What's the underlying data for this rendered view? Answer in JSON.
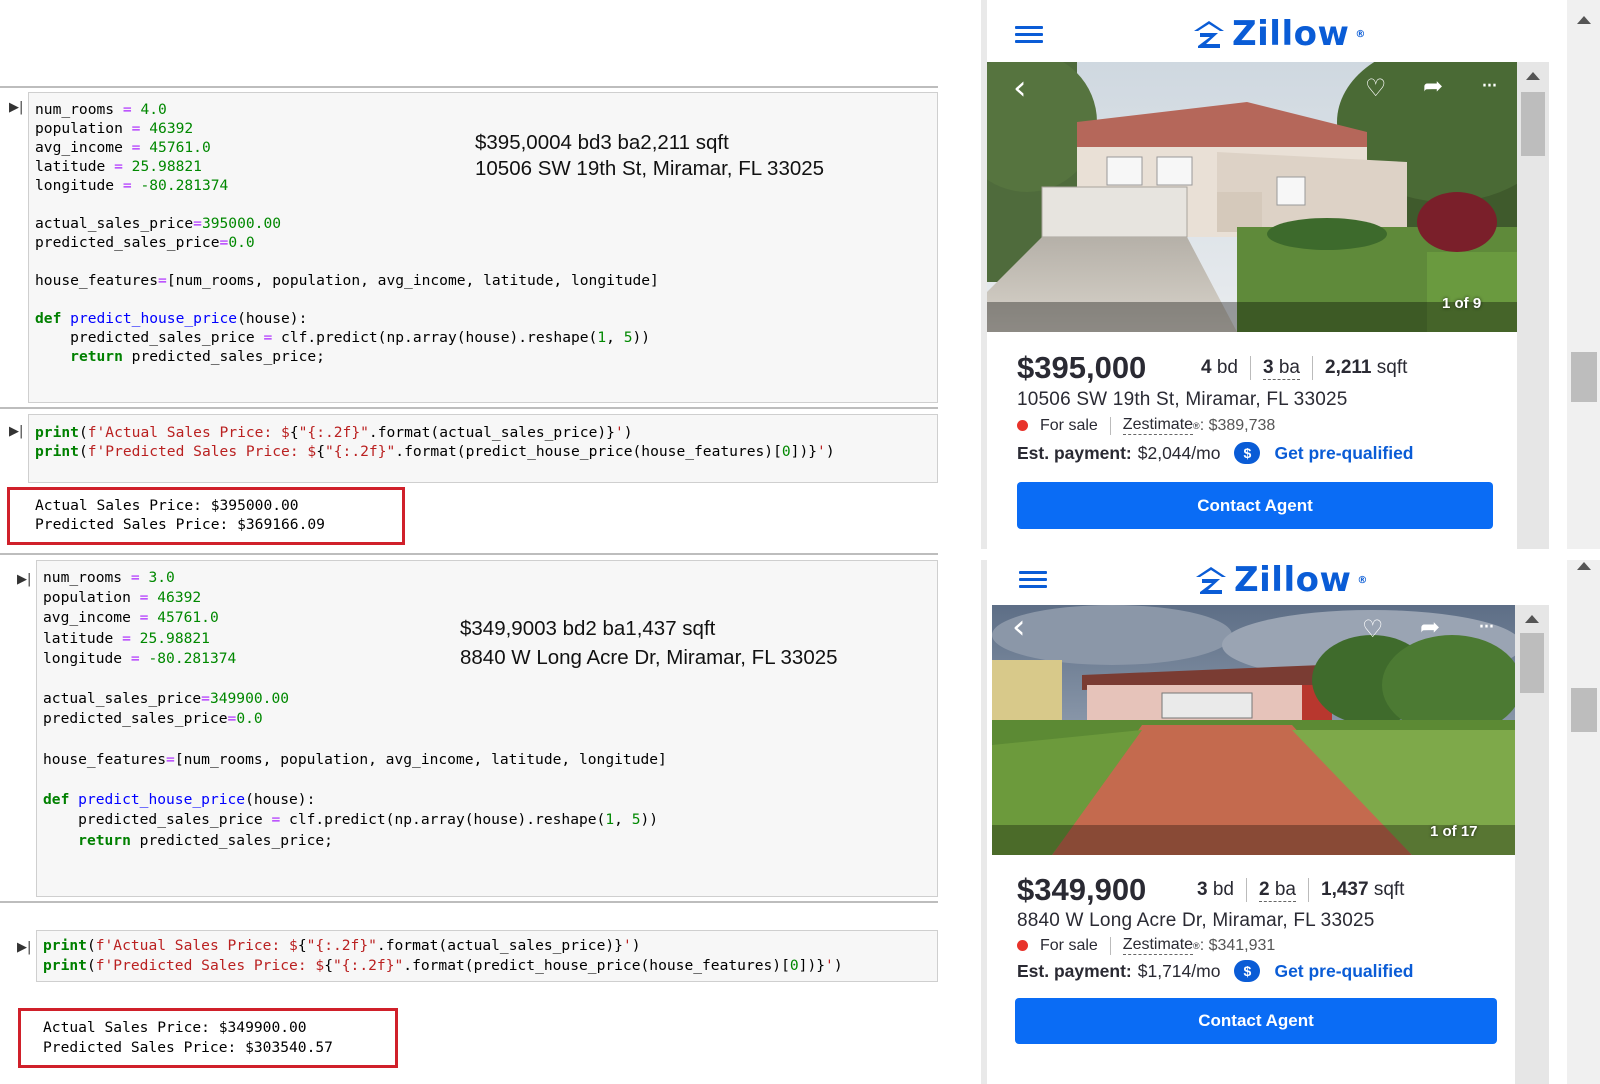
{
  "cells": [
    {
      "input_lines": [
        [
          [
            "num_rooms ",
            ""
          ],
          [
            "=",
            "op"
          ],
          [
            " ",
            ""
          ],
          [
            "4.0",
            "num"
          ]
        ],
        [
          [
            "population ",
            ""
          ],
          [
            "=",
            "op"
          ],
          [
            " ",
            ""
          ],
          [
            "46392",
            "num"
          ]
        ],
        [
          [
            "avg_income ",
            ""
          ],
          [
            "=",
            "op"
          ],
          [
            " ",
            ""
          ],
          [
            "45761.0",
            "num"
          ]
        ],
        [
          [
            "latitude ",
            ""
          ],
          [
            "=",
            "op"
          ],
          [
            " ",
            ""
          ],
          [
            "25.98821",
            "num"
          ]
        ],
        [
          [
            "longitude ",
            ""
          ],
          [
            "=",
            "op"
          ],
          [
            " ",
            ""
          ],
          [
            "-80.281374",
            "num"
          ]
        ],
        [],
        [
          [
            "actual_sales_price",
            ""
          ],
          [
            "=",
            "op"
          ],
          [
            "395000.00",
            "num"
          ]
        ],
        [
          [
            "predicted_sales_price",
            ""
          ],
          [
            "=",
            "op"
          ],
          [
            "0.0",
            "num"
          ]
        ],
        [],
        [
          [
            "house_features",
            ""
          ],
          [
            "=",
            "op"
          ],
          [
            "[num_rooms, population, avg_income, latitude, longitude]",
            ""
          ]
        ],
        [],
        [
          [
            "def",
            "kw"
          ],
          [
            " ",
            ""
          ],
          [
            "predict_house_price",
            "fn"
          ],
          [
            "(house):",
            ""
          ]
        ],
        [
          [
            "    predicted_sales_price ",
            ""
          ],
          [
            "=",
            "op"
          ],
          [
            " clf.predict(np.array(house).reshape(",
            ""
          ],
          [
            "1",
            "num"
          ],
          [
            ", ",
            ""
          ],
          [
            "5",
            "num"
          ],
          [
            "))",
            ""
          ]
        ],
        [
          [
            "    ",
            ""
          ],
          [
            "return",
            "kw"
          ],
          [
            " predicted_sales_price;",
            ""
          ]
        ]
      ],
      "note_line1": "$395,0004 bd3 ba2,211 sqft",
      "note_line2": "10506 SW 19th St, Miramar, FL 33025",
      "print_lines": [
        [
          [
            "print",
            "kw"
          ],
          [
            "(",
            ""
          ],
          [
            "f'Actual Sales Price: $",
            "str"
          ],
          [
            "{",
            ""
          ],
          [
            "\"{:.2f}\"",
            "str"
          ],
          [
            ".format(actual_sales_price)}",
            ""
          ],
          [
            "'",
            "str"
          ],
          [
            ")",
            ""
          ]
        ],
        [
          [
            "print",
            "kw"
          ],
          [
            "(",
            ""
          ],
          [
            "f'Predicted Sales Price: $",
            "str"
          ],
          [
            "{",
            ""
          ],
          [
            "\"{:.2f}\"",
            "str"
          ],
          [
            ".format(predict_house_price(house_features)[",
            ""
          ],
          [
            "0",
            "num"
          ],
          [
            "])}",
            ""
          ],
          [
            "'",
            "str"
          ],
          [
            ")",
            ""
          ]
        ]
      ],
      "output_line1": "Actual Sales Price: $395000.00",
      "output_line2": "Predicted Sales Price: $369166.09"
    },
    {
      "input_lines": [
        [
          [
            "num_rooms ",
            ""
          ],
          [
            "=",
            "op"
          ],
          [
            " ",
            ""
          ],
          [
            "3.0",
            "num"
          ]
        ],
        [
          [
            "population ",
            ""
          ],
          [
            "=",
            "op"
          ],
          [
            " ",
            ""
          ],
          [
            "46392",
            "num"
          ]
        ],
        [
          [
            "avg_income ",
            ""
          ],
          [
            "=",
            "op"
          ],
          [
            " ",
            ""
          ],
          [
            "45761.0",
            "num"
          ]
        ],
        [
          [
            "latitude ",
            ""
          ],
          [
            "=",
            "op"
          ],
          [
            " ",
            ""
          ],
          [
            "25.98821",
            "num"
          ]
        ],
        [
          [
            "longitude ",
            ""
          ],
          [
            "=",
            "op"
          ],
          [
            " ",
            ""
          ],
          [
            "-80.281374",
            "num"
          ]
        ],
        [],
        [
          [
            "actual_sales_price",
            ""
          ],
          [
            "=",
            "op"
          ],
          [
            "349900.00",
            "num"
          ]
        ],
        [
          [
            "predicted_sales_price",
            ""
          ],
          [
            "=",
            "op"
          ],
          [
            "0.0",
            "num"
          ]
        ],
        [],
        [
          [
            "house_features",
            ""
          ],
          [
            "=",
            "op"
          ],
          [
            "[num_rooms, population, avg_income, latitude, longitude]",
            ""
          ]
        ],
        [],
        [
          [
            "def",
            "kw"
          ],
          [
            " ",
            ""
          ],
          [
            "predict_house_price",
            "fn"
          ],
          [
            "(house):",
            ""
          ]
        ],
        [
          [
            "    predicted_sales_price ",
            ""
          ],
          [
            "=",
            "op"
          ],
          [
            " clf.predict(np.array(house).reshape(",
            ""
          ],
          [
            "1",
            "num"
          ],
          [
            ", ",
            ""
          ],
          [
            "5",
            "num"
          ],
          [
            "))",
            ""
          ]
        ],
        [
          [
            "    ",
            ""
          ],
          [
            "return",
            "kw"
          ],
          [
            " predicted_sales_price;",
            ""
          ]
        ]
      ],
      "note_line1": "$349,9003 bd2 ba1,437 sqft",
      "note_line2": "8840 W Long Acre Dr, Miramar, FL 33025",
      "print_lines": [
        [
          [
            "print",
            "kw"
          ],
          [
            "(",
            ""
          ],
          [
            "f'Actual Sales Price: $",
            "str"
          ],
          [
            "{",
            ""
          ],
          [
            "\"{:.2f}\"",
            "str"
          ],
          [
            ".format(actual_sales_price)}",
            ""
          ],
          [
            "'",
            "str"
          ],
          [
            ")",
            ""
          ]
        ],
        [
          [
            "print",
            "kw"
          ],
          [
            "(",
            ""
          ],
          [
            "f'Predicted Sales Price: $",
            "str"
          ],
          [
            "{",
            ""
          ],
          [
            "\"{:.2f}\"",
            "str"
          ],
          [
            ".format(predict_house_price(house_features)[",
            ""
          ],
          [
            "0",
            "num"
          ],
          [
            "])}",
            ""
          ],
          [
            "'",
            "str"
          ],
          [
            ")",
            ""
          ]
        ]
      ],
      "output_line1": "Actual Sales Price: $349900.00",
      "output_line2": "Predicted Sales Price: $303540.57"
    }
  ],
  "listings": [
    {
      "logo": "Zillow",
      "photo_count": "1 of 9",
      "price": "$395,000",
      "beds": "4",
      "beds_unit": "bd",
      "baths": "3",
      "baths_unit": "ba",
      "sqft": "2,211",
      "sqft_unit": "sqft",
      "address": "10506 SW 19th St, Miramar, FL 33025",
      "status": "For sale",
      "zestimate_label": "Zestimate",
      "zestimate_value": ": $389,738",
      "est_payment_label": "Est. payment:",
      "est_payment_value": "$2,044/mo",
      "prequal_label": "Get pre-qualified",
      "contact_label": "Contact Agent"
    },
    {
      "logo": "Zillow",
      "photo_count": "1 of 17",
      "price": "$349,900",
      "beds": "3",
      "beds_unit": "bd",
      "baths": "2",
      "baths_unit": "ba",
      "sqft": "1,437",
      "sqft_unit": "sqft",
      "address": "8840 W Long Acre Dr, Miramar, FL 33025",
      "status": "For sale",
      "zestimate_label": "Zestimate",
      "zestimate_value": ": $341,931",
      "est_payment_label": "Est. payment:",
      "est_payment_value": "$1,714/mo",
      "prequal_label": "Get pre-qualified",
      "contact_label": "Contact Agent"
    }
  ],
  "colors": {
    "zillow_blue": "#0a5cd6",
    "contact_button": "#0a6cf5",
    "output_border": "#d0202a",
    "for_sale_dot": "#e8332b"
  },
  "icons": [
    "run-cell-icon",
    "hamburger-menu-icon",
    "zillow-logo-icon",
    "back-arrow-icon",
    "heart-icon",
    "share-icon",
    "more-icon",
    "dollar-icon",
    "scroll-up-arrow-icon"
  ]
}
